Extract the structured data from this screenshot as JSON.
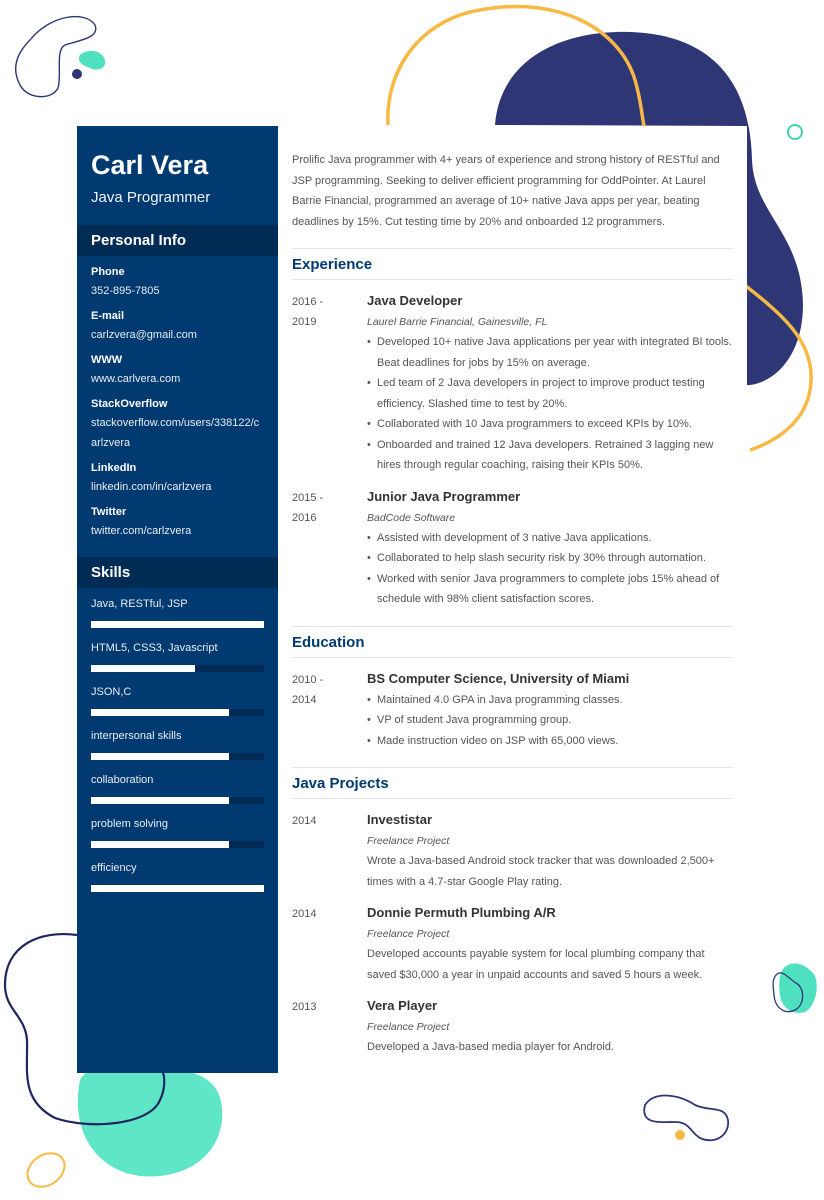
{
  "profile": {
    "name": "Carl Vera",
    "role": "Java Programmer"
  },
  "personal_info": {
    "heading": "Personal Info",
    "items": [
      {
        "label": "Phone",
        "value": "352-895-7805"
      },
      {
        "label": "E-mail",
        "value": "carlzvera@gmail.com"
      },
      {
        "label": "WWW",
        "value": "www.carlvera.com"
      },
      {
        "label": "StackOverflow",
        "value": "stackoverflow.com/users/338122/carlzvera"
      },
      {
        "label": "LinkedIn",
        "value": "linkedin.com/in/carlzvera"
      },
      {
        "label": "Twitter",
        "value": "twitter.com/carlzvera"
      }
    ]
  },
  "skills": {
    "heading": "Skills",
    "items": [
      {
        "name": "Java, RESTful, JSP",
        "level": 1.0
      },
      {
        "name": "HTML5, CSS3, Javascript",
        "level": 0.6
      },
      {
        "name": "JSON,C",
        "level": 0.8
      },
      {
        "name": "interpersonal skills",
        "level": 0.8
      },
      {
        "name": "collaboration",
        "level": 0.8
      },
      {
        "name": "problem solving",
        "level": 0.8
      },
      {
        "name": "efficiency",
        "level": 1.0
      }
    ]
  },
  "summary": "Prolific Java programmer with 4+ years of experience and strong history of RESTful and JSP programming. Seeking to deliver efficient programming for OddPointer. At Laurel Barrie Financial, programmed an average of 10+ native Java apps per year, beating deadlines by 15%. Cut testing time by 20% and onboarded 12 programmers.",
  "experience": {
    "heading": "Experience",
    "entries": [
      {
        "date_start": "2016 -",
        "date_end": "2019",
        "title": "Java Developer",
        "org": "Laurel Barrie Financial, Gainesville, FL",
        "bullets": [
          "Developed 10+ native Java applications per year with integrated BI tools. Beat deadlines for jobs by 15% on average.",
          "Led team of 2 Java developers in project to improve product testing efficiency. Slashed time to test by 20%.",
          "Collaborated with 10 Java programmers to exceed KPIs by 10%.",
          "Onboarded and trained 12 Java developers. Retrained 3 lagging new hires through regular coaching, raising their KPIs 50%."
        ]
      },
      {
        "date_start": "2015 -",
        "date_end": "2016",
        "title": "Junior Java Programmer",
        "org": "BadCode Software",
        "bullets": [
          "Assisted with development of 3 native Java applications.",
          "Collaborated to help slash security risk by 30% through automation.",
          "Worked with senior Java programmers to complete jobs 15% ahead of schedule with 98% client satisfaction scores."
        ]
      }
    ]
  },
  "education": {
    "heading": "Education",
    "entries": [
      {
        "date_start": "2010 -",
        "date_end": "2014",
        "title": "BS Computer Science, University of Miami",
        "bullets": [
          "Maintained 4.0 GPA in Java programming classes.",
          "VP of student Java programming group.",
          "Made instruction video on JSP with 65,000 views."
        ]
      }
    ]
  },
  "projects": {
    "heading": "Java Projects",
    "entries": [
      {
        "date": "2014",
        "title": "Investistar",
        "org": "Freelance Project",
        "desc": "Wrote a Java-based Android stock tracker that was downloaded 2,500+ times with a 4.7-star Google Play rating."
      },
      {
        "date": "2014",
        "title": "Donnie Permuth Plumbing A/R",
        "org": "Freelance Project",
        "desc": "Developed accounts payable system for local plumbing company that saved $30,000 a year in unpaid accounts and saved 5 hours a week."
      },
      {
        "date": "2013",
        "title": "Vera Player",
        "org": "Freelance Project",
        "desc": "Developed a Java-based media player for Android."
      }
    ]
  },
  "colors": {
    "sidebar": "#003a70",
    "sidebar_header": "#002b55",
    "accent_navy": "#2e3675",
    "accent_teal": "#4fe0c0",
    "accent_yellow": "#f7b944"
  }
}
